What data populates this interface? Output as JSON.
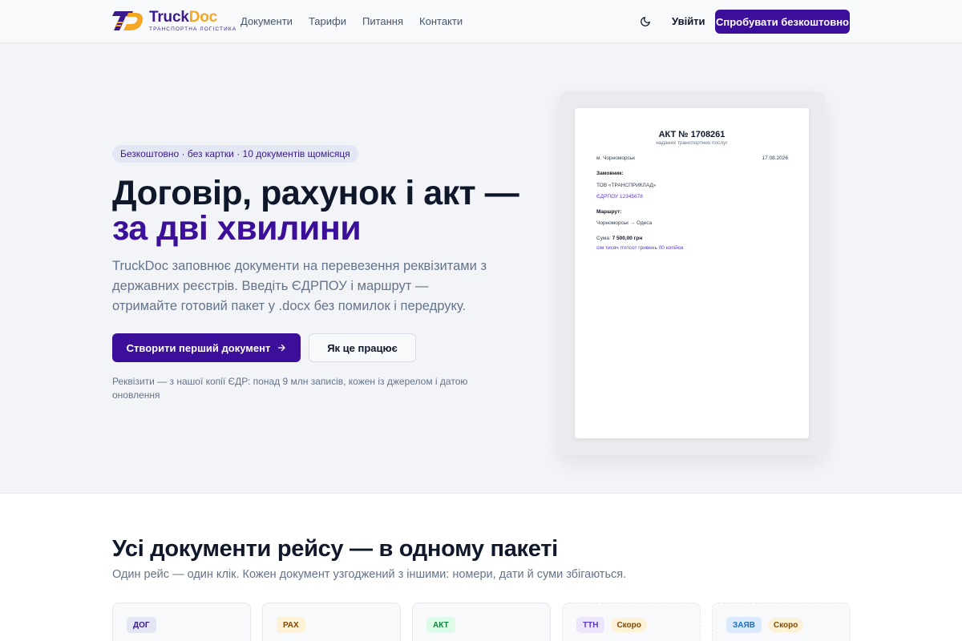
{
  "header": {
    "logo_name_part1": "Truck",
    "logo_name_part2": "Doc",
    "logo_subtitle": "транспортна логістика",
    "nav": [
      {
        "label": "Документи"
      },
      {
        "label": "Тарифи"
      },
      {
        "label": "Питання"
      },
      {
        "label": "Контакти"
      }
    ],
    "theme_icon": "moon-icon",
    "login_label": "Увійти",
    "cta_label": "Спробувати безкоштовно"
  },
  "hero": {
    "pill": "Безкоштовно · без картки · 10 документів щомісяця",
    "title_plain": "Договір, рахунок і акт — ",
    "title_accent": "за дві хвилини",
    "description": "TruckDoc заповнює документи на перевезення реквізитами з державних реєстрів. Введіть ЄДРПОУ і маршрут — отримайте готовий пакет у .docx без помилок і передруку.",
    "primary_button": "Створити перший документ",
    "primary_button_icon": "arrow-right-icon",
    "secondary_button": "Як це працює",
    "note": "Реквізити — з нашої копії ЄДР: понад 9 млн записів, кожен із джерелом і датою оновлення"
  },
  "document_preview": {
    "title": "АКТ № 1708261",
    "subtitle": "наданих транспортних послуг",
    "city": "м. Чорноморськ",
    "date": "17.08.2026",
    "customer_label": "Замовник:",
    "customer_name": "ТОВ «ТРАНСПРИКЛАД»",
    "customer_code": "ЄДРПОУ 12345678",
    "route_label": "Маршрут:",
    "route_value": "Чорноморськ → Одеса",
    "sum_label": "Сума:",
    "sum_value": "7 500,00 грн",
    "sum_words": "сім тисяч п'ятсот гривень 00 копійок"
  },
  "documents_section": {
    "title": "Усі документи рейсу — в одному пакеті",
    "subtitle": "Один рейс — один клік. Кожен документ узгоджений з іншими: номери, дати й суми збігаються.",
    "cards": [
      {
        "tag": "ДОГ",
        "tag_bg": "#e3e6f3",
        "tag_color": "#3b1a8f",
        "soon": ""
      },
      {
        "tag": "РАХ",
        "tag_bg": "#fdf1d8",
        "tag_color": "#7a4a06",
        "soon": ""
      },
      {
        "tag": "АКТ",
        "tag_bg": "#dcfce7",
        "tag_color": "#15803d",
        "soon": ""
      },
      {
        "tag": "ТТН",
        "tag_bg": "#ede5fb",
        "tag_color": "#5b3cc4",
        "soon": "Скоро"
      },
      {
        "tag": "ЗАЯВ",
        "tag_bg": "#dbeafe",
        "tag_color": "#1d6fb8",
        "soon": "Скоро"
      }
    ]
  }
}
